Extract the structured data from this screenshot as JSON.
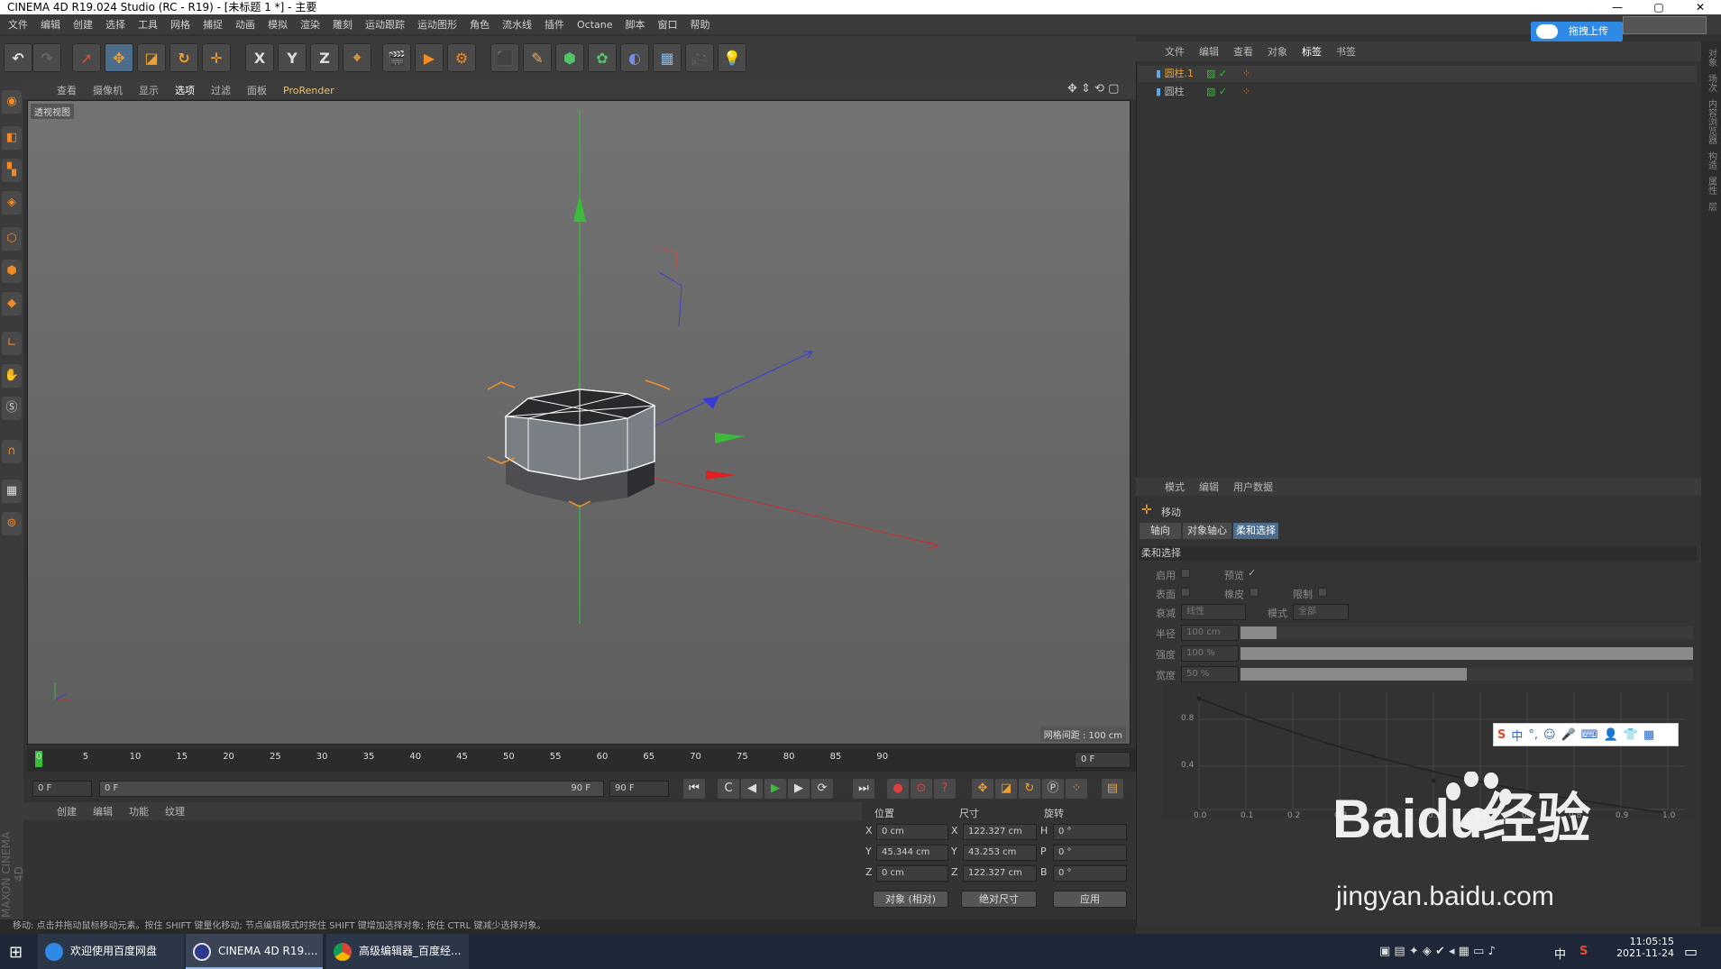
{
  "window": {
    "title": "CINEMA 4D R19.024 Studio (RC - R19) - [未标题 1 *] - 主要",
    "controls": [
      "—",
      "▢",
      "✕"
    ]
  },
  "menu": [
    "文件",
    "编辑",
    "创建",
    "选择",
    "工具",
    "网格",
    "捕捉",
    "动画",
    "模拟",
    "渲染",
    "雕刻",
    "运动跟踪",
    "运动图形",
    "角色",
    "流水线",
    "插件",
    "Octane",
    "脚本",
    "窗口",
    "帮助"
  ],
  "upload_button": "拖拽上传",
  "toolbar": {
    "axis_x": "X",
    "axis_y": "Y",
    "axis_z": "Z"
  },
  "viewport": {
    "menu": [
      "查看",
      "摄像机",
      "显示",
      "选项",
      "过滤",
      "面板",
      "ProRender"
    ],
    "label": "透视视图",
    "grid_info": "网格间距 : 100 cm"
  },
  "timeline": {
    "ticks": [
      "0",
      "5",
      "10",
      "15",
      "20",
      "25",
      "30",
      "35",
      "40",
      "45",
      "50",
      "55",
      "60",
      "65",
      "70",
      "75",
      "80",
      "85",
      "90"
    ],
    "current_frame": "0 F",
    "start": "0 F",
    "range_start": "0 F",
    "range_end": "90 F",
    "end": "90 F"
  },
  "materials": {
    "menu": [
      "创建",
      "编辑",
      "功能",
      "纹理"
    ],
    "brand": "MAXON CINEMA 4D"
  },
  "coords": {
    "headers": {
      "position": "位置",
      "size": "尺寸",
      "rotation": "旋转"
    },
    "pos_x": "0 cm",
    "pos_y": "45.344 cm",
    "pos_z": "0 cm",
    "size_x": "122.327 cm",
    "size_y": "43.253 cm",
    "size_z": "122.327 cm",
    "rot_h": "0 °",
    "rot_p": "0 °",
    "rot_b": "0 °",
    "axes": {
      "x": "X",
      "y": "Y",
      "z": "Z",
      "h": "H",
      "p": "P",
      "b": "B"
    },
    "mode_dropdown": "对象 (相对)",
    "size_dropdown": "绝对尺寸",
    "apply_button": "应用"
  },
  "status": "移动: 点击并拖动鼠标移动元素。按住 SHIFT 键量化移动; 节点编辑模式时按住 SHIFT 键增加选择对象; 按住 CTRL 键减少选择对象。",
  "objects": {
    "menu": [
      "文件",
      "编辑",
      "查看",
      "对象",
      "标签",
      "书签"
    ],
    "items": [
      {
        "name": "圆柱.1"
      },
      {
        "name": "圆柱"
      }
    ]
  },
  "attributes": {
    "menu": [
      "模式",
      "编辑",
      "用户数据"
    ],
    "tool_name": "移动",
    "tabs": [
      "轴向",
      "对象轴心",
      "柔和选择"
    ],
    "section": "柔和选择",
    "enable": "启用",
    "preview": "预览",
    "surface": "表面",
    "rubber": "橡皮",
    "restrict": "限制",
    "falloff": "衰减",
    "falloff_value": "线性",
    "mode": "模式",
    "mode_value": "全部",
    "radius": "半径",
    "radius_value": "100 cm",
    "radius_fill": 0.08,
    "strength": "强度",
    "strength_value": "100 %",
    "strength_fill": 1.0,
    "width": "宽度",
    "width_value": "50 %",
    "width_fill": 0.5,
    "graph_y": [
      "0.8",
      "0.4"
    ],
    "graph_x": [
      "0.0",
      "0.1",
      "0.2",
      "0.3",
      "0.4",
      "0.5",
      "0.6",
      "0.7",
      "0.8",
      "0.9",
      "1.0"
    ]
  },
  "right_strip": [
    "对象",
    "场次",
    "内容浏览器",
    "构造",
    "属性",
    "层"
  ],
  "ime": [
    "中",
    "°,",
    "☺",
    "🎤",
    "⌨",
    "👤",
    "👕",
    "▦"
  ],
  "watermark": {
    "main": "Baidu经验",
    "url": "jingyan.baidu.com"
  },
  "taskbar": {
    "tasks": [
      "欢迎使用百度网盘",
      "CINEMA 4D R19....",
      "高级编辑器_百度经..."
    ],
    "ime_indicator": "中",
    "time": "11:05:15",
    "date": "2021-11-24"
  }
}
